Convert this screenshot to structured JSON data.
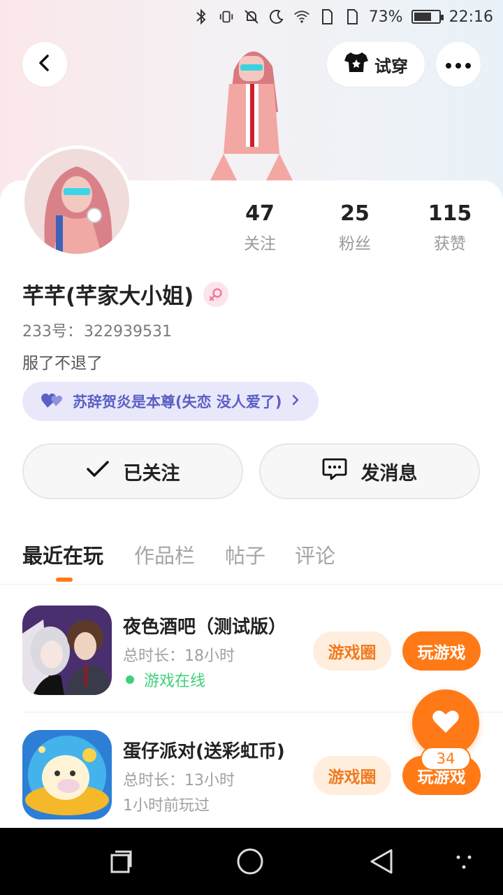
{
  "status_bar": {
    "battery": "73%",
    "battery_level": 0.73,
    "time": "22:16"
  },
  "header": {
    "try_on_label": "试穿"
  },
  "stats": [
    {
      "count": "47",
      "label": "关注"
    },
    {
      "count": "25",
      "label": "粉丝"
    },
    {
      "count": "115",
      "label": "获赞"
    }
  ],
  "profile": {
    "name": "芊芊(芊家大小姐)",
    "id_label": "233号：",
    "id_value": "322939531",
    "bio": "服了不退了",
    "cp_text": "苏辞贺炎是本尊(失恋 没人爱了)"
  },
  "actions": {
    "follow_label": "已关注",
    "message_label": "发消息"
  },
  "tabs": [
    {
      "label": "最近在玩",
      "active": true
    },
    {
      "label": "作品栏",
      "active": false
    },
    {
      "label": "帖子",
      "active": false
    },
    {
      "label": "评论",
      "active": false
    }
  ],
  "games": [
    {
      "title": "夜色酒吧（测试版）",
      "duration": "总时长：18小时",
      "status": "游戏在线",
      "circle_label": "游戏圈",
      "play_label": "玩游戏"
    },
    {
      "title": "蛋仔派对(送彩虹币)",
      "duration": "总时长：13小时",
      "status": "1小时前玩过",
      "circle_label": "游戏圈",
      "play_label": "玩游戏"
    }
  ],
  "like_fab": {
    "count": "34"
  },
  "colors": {
    "accent": "#ff7a16",
    "online": "#3fcf7a",
    "cp_chip_bg": "#e9e8fb",
    "cp_chip_text": "#5a5fc5"
  }
}
